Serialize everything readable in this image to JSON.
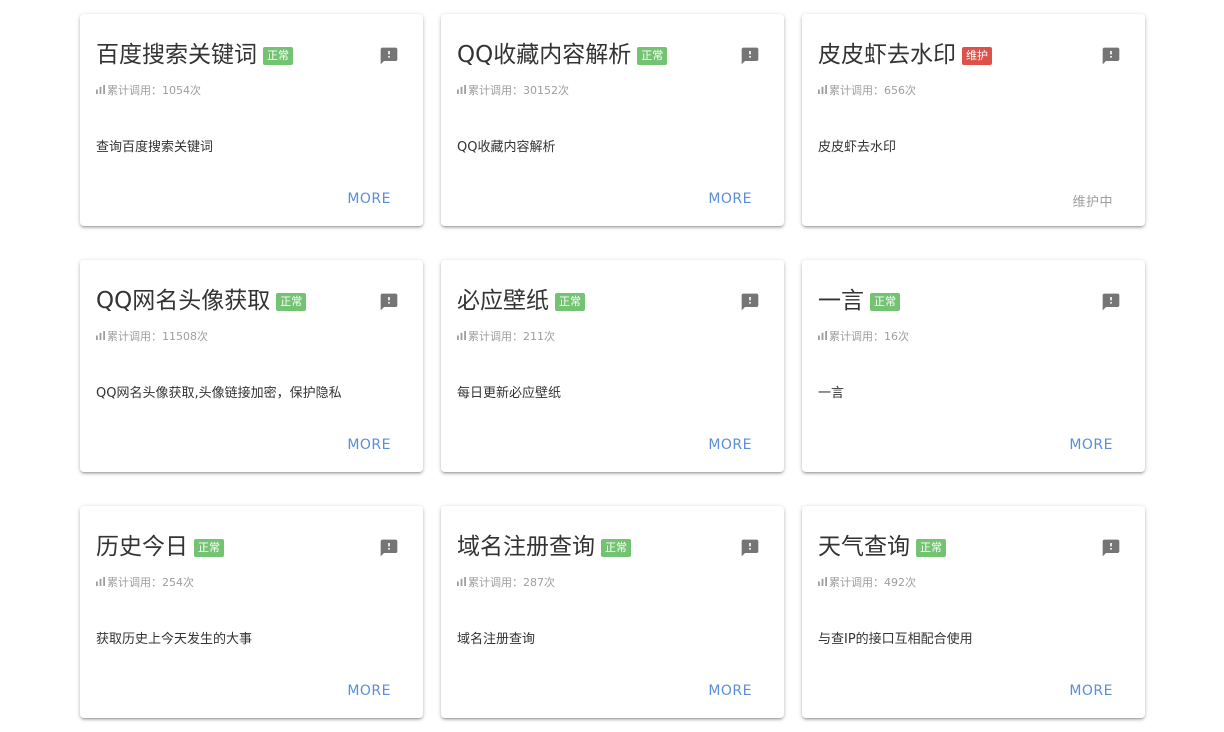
{
  "colors": {
    "status_normal": "#73c373",
    "status_maintenance": "#e0504a",
    "link": "#5b8ed6",
    "icon": "#757575"
  },
  "icons": {
    "feedback": "comment-alert-icon",
    "stats": "bar-chart-icon"
  },
  "cards": [
    {
      "title": "百度搜索关键词",
      "status": "正常",
      "status_type": "normal",
      "calls": "累计调用：1054次",
      "desc": "查询百度搜索关键词",
      "action": "MORE"
    },
    {
      "title": "QQ收藏内容解析",
      "status": "正常",
      "status_type": "normal",
      "calls": "累计调用：30152次",
      "desc": "QQ收藏内容解析",
      "action": "MORE"
    },
    {
      "title": "皮皮虾去水印",
      "status": "维护",
      "status_type": "maintenance",
      "calls": "累计调用：656次",
      "desc": "皮皮虾去水印",
      "action": "维护中"
    },
    {
      "title": "QQ网名头像获取",
      "status": "正常",
      "status_type": "normal",
      "calls": "累计调用：11508次",
      "desc": "QQ网名头像获取,头像链接加密，保护隐私",
      "action": "MORE"
    },
    {
      "title": "必应壁纸",
      "status": "正常",
      "status_type": "normal",
      "calls": "累计调用：211次",
      "desc": "每日更新必应壁纸",
      "action": "MORE"
    },
    {
      "title": "一言",
      "status": "正常",
      "status_type": "normal",
      "calls": "累计调用：16次",
      "desc": "一言",
      "action": "MORE"
    },
    {
      "title": "历史今日",
      "status": "正常",
      "status_type": "normal",
      "calls": "累计调用：254次",
      "desc": "获取历史上今天发生的大事",
      "action": "MORE"
    },
    {
      "title": "域名注册查询",
      "status": "正常",
      "status_type": "normal",
      "calls": "累计调用：287次",
      "desc": "域名注册查询",
      "action": "MORE"
    },
    {
      "title": "天气查询",
      "status": "正常",
      "status_type": "normal",
      "calls": "累计调用：492次",
      "desc": "与查IP的接口互相配合使用",
      "action": "MORE"
    }
  ]
}
